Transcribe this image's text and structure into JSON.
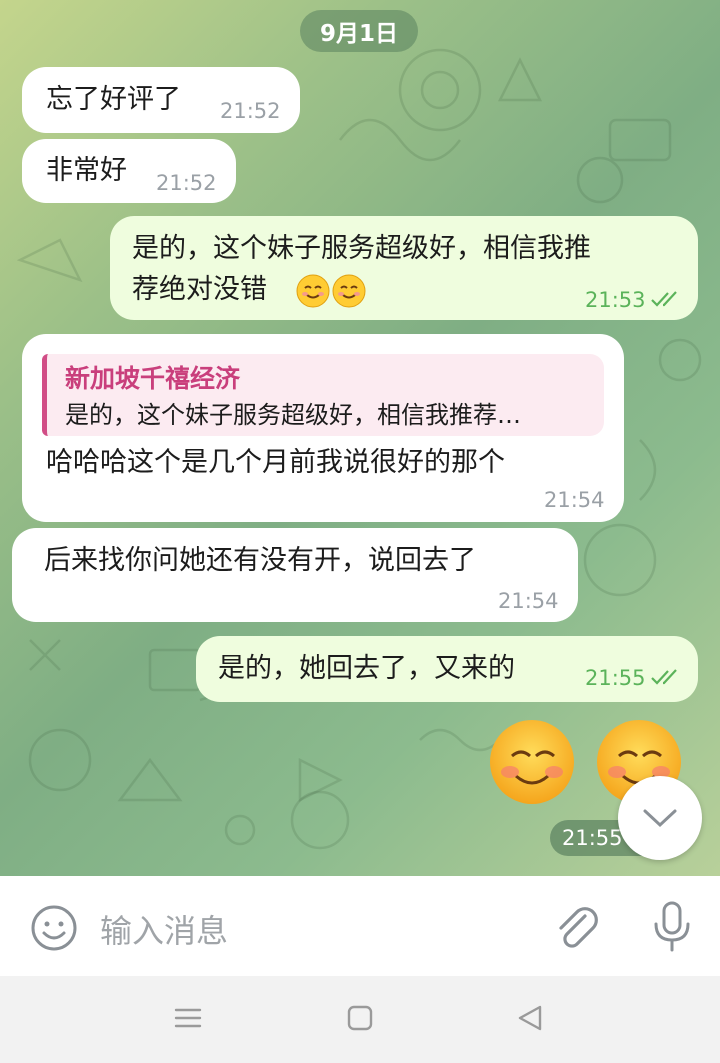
{
  "date_separator": "9月1日",
  "messages": [
    {
      "direction": "incoming",
      "text": "忘了好评了",
      "time": "21:52"
    },
    {
      "direction": "incoming",
      "text": "非常好",
      "time": "21:52"
    },
    {
      "direction": "outgoing",
      "text_line1": "是的，这个妹子服务超级好，相信我推",
      "text_line2": "荐绝对没错",
      "emoji": "smiling-face-emoji",
      "time": "21:53",
      "read": true
    },
    {
      "direction": "incoming",
      "reply_author": "新加坡千禧经济",
      "reply_text": "是的，这个妹子服务超级好，相信我推荐…",
      "text": "哈哈哈这个是几个月前我说很好的那个",
      "time": "21:54"
    },
    {
      "direction": "incoming",
      "text": "后来找你问她还有没有开，说回去了",
      "time": "21:54"
    },
    {
      "direction": "outgoing",
      "text": "是的，她回去了，又来的",
      "time": "21:55",
      "read": true
    },
    {
      "direction": "outgoing",
      "sticker": "smiling-face-sticker",
      "time": "21:55"
    }
  ],
  "input": {
    "placeholder": "输入消息"
  },
  "icons": {
    "emoji_button": "smiley-icon",
    "attach": "paperclip-icon",
    "mic": "microphone-icon",
    "scroll_down": "chevron-down-icon",
    "nav_menu": "menu-icon",
    "nav_home": "square-icon",
    "nav_back": "triangle-back-icon"
  },
  "colors": {
    "outgoing_bubble": "#effdde",
    "incoming_bubble": "#ffffff",
    "outgoing_time": "#5bb35a",
    "reply_accent": "#d14d86"
  }
}
